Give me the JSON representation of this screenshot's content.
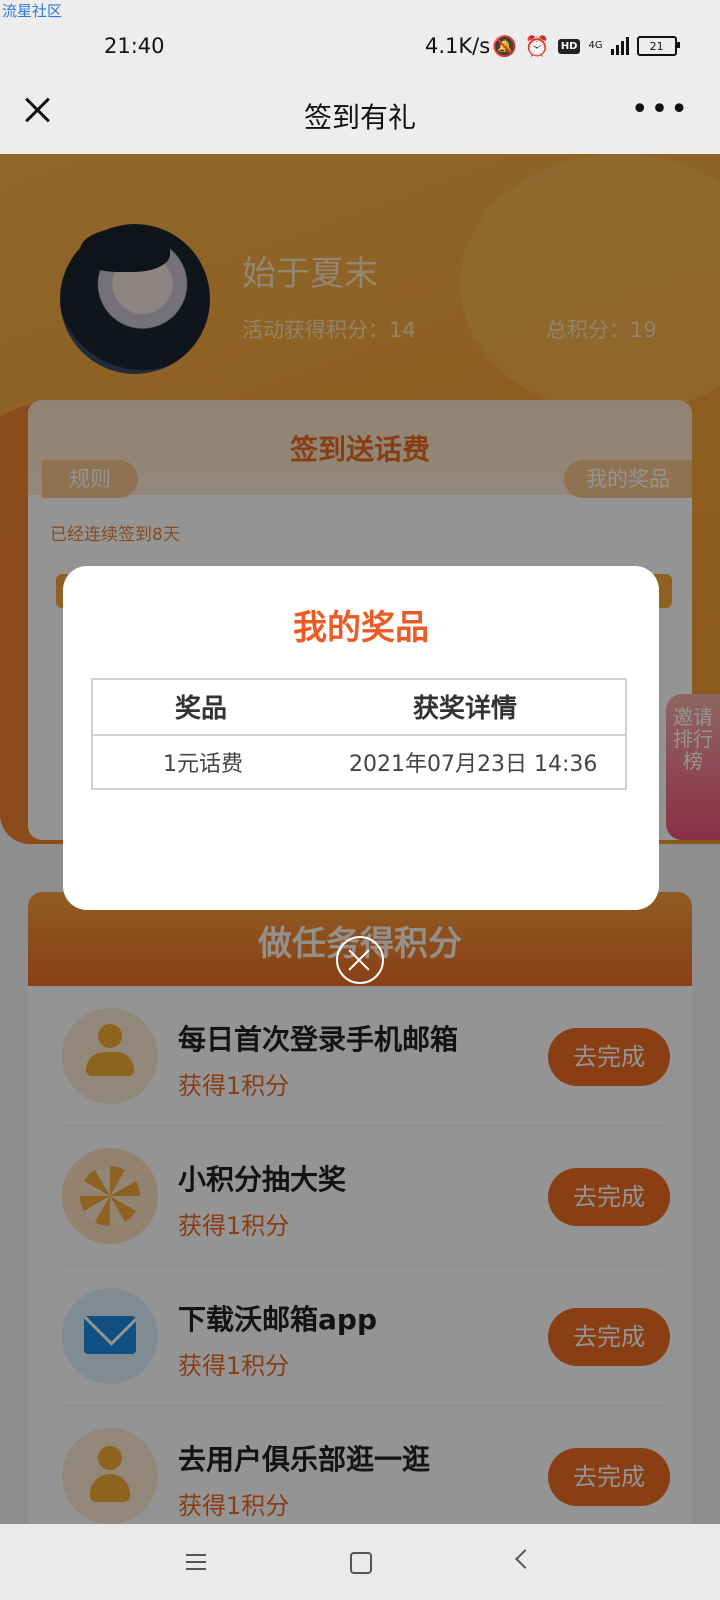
{
  "watermark": "流星社区",
  "status_bar": {
    "time": "21:40",
    "speed": "4.1K/s",
    "network": "4G",
    "hd": "HD",
    "battery": "21"
  },
  "nav": {
    "title": "签到有礼",
    "more": "•••"
  },
  "profile": {
    "username": "始于夏末",
    "activity_points": "活动获得积分：14",
    "total_points": "总积分：19"
  },
  "sign_card": {
    "title": "签到送话费",
    "rules_label": "规则",
    "my_prizes_label": "我的奖品",
    "streak_text": "已经连续签到8天"
  },
  "rank_tab": "邀请排行榜",
  "tasks_card": {
    "title": "做任务得积分",
    "items": [
      {
        "name": "每日首次登录手机邮箱",
        "points": "获得1积分",
        "button": "去完成",
        "icon": "user-icon",
        "icon_bg": "#fbe9d0"
      },
      {
        "name": "小积分抽大奖",
        "points": "获得1积分",
        "button": "去完成",
        "icon": "wheel-icon",
        "icon_bg": "#fbe0c0"
      },
      {
        "name": "下载沃邮箱app",
        "points": "获得1积分",
        "button": "去完成",
        "icon": "mail-icon",
        "icon_bg": "#dff0fb"
      },
      {
        "name": "去用户俱乐部逛一逛",
        "points": "获得1积分",
        "button": "去完成",
        "icon": "star-user-icon",
        "icon_bg": "#fbe9d0"
      }
    ]
  },
  "modal": {
    "title": "我的奖品",
    "headers": {
      "prize": "奖品",
      "detail": "获奖详情"
    },
    "rows": [
      {
        "prize": "1元话费",
        "detail": "2021年07月23日 14:36"
      }
    ]
  },
  "colors": {
    "accent": "#ee6b23",
    "modal_title": "#ee5a24",
    "hero": "#f5a33a"
  }
}
